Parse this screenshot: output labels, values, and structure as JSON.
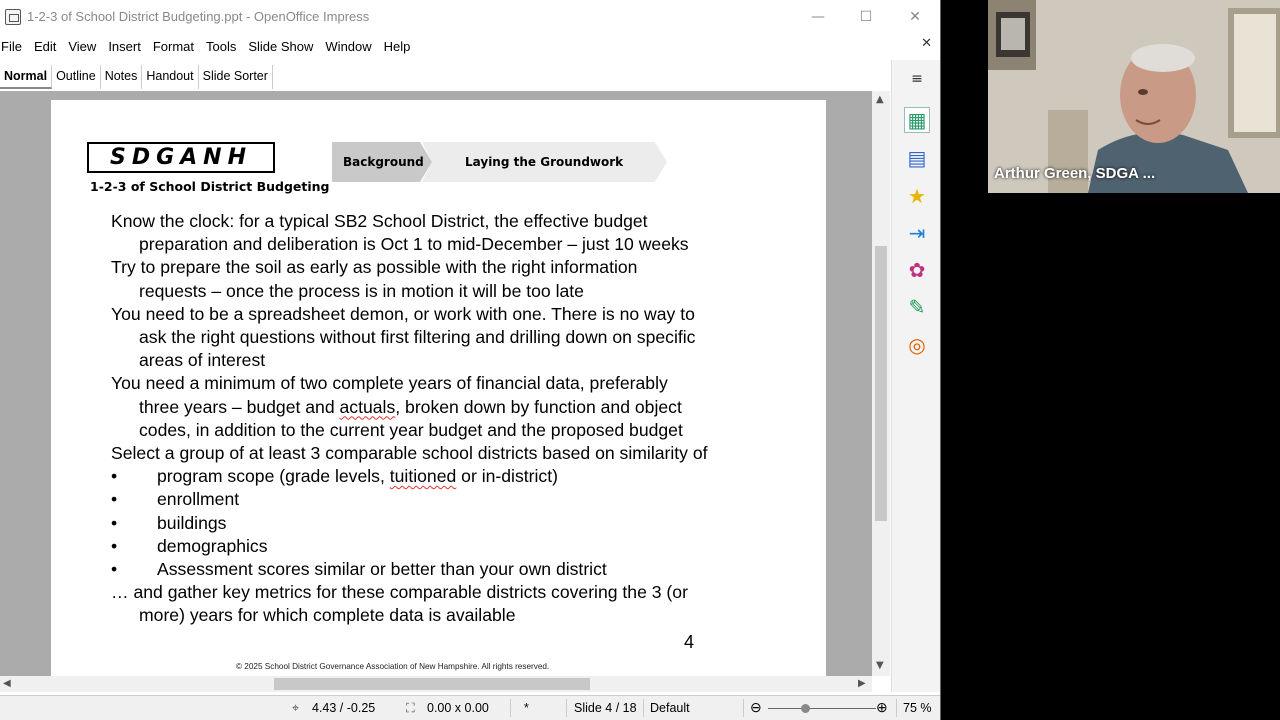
{
  "window": {
    "title": "1-2-3 of School District Budgeting.ppt - OpenOffice Impress",
    "minimize": "—",
    "maximize": "☐",
    "close": "✕",
    "doc_close": "✕"
  },
  "menu": [
    "File",
    "Edit",
    "View",
    "Insert",
    "Format",
    "Tools",
    "Slide Show",
    "Window",
    "Help"
  ],
  "view_tabs": [
    "Normal",
    "Outline",
    "Notes",
    "Handout",
    "Slide Sorter"
  ],
  "active_tab": "Normal",
  "slide": {
    "logo": "SDGANH",
    "logo_subtitle": "1-2-3 of School District Budgeting",
    "breadcrumb": [
      "Background",
      "Laying the Groundwork"
    ],
    "paragraphs": [
      {
        "first": "Know the clock: for a typical SB2 School District, the effective budget",
        "cont": [
          "preparation and deliberation is Oct 1 to mid-December – just 10 weeks"
        ]
      },
      {
        "first": "Try to prepare the soil as early as possible with the right information",
        "cont": [
          "requests – once the process is in motion it will be too late"
        ]
      },
      {
        "first": "You need to be a spreadsheet demon, or work with one.  There is no way to",
        "cont": [
          "ask the right questions without first filtering and drilling down on specific",
          "areas of interest"
        ]
      },
      {
        "first": "You need a minimum of two complete years of financial data, preferably",
        "cont_a": "three years – budget and ",
        "cont_b": "actuals",
        "cont_c": ", broken down by function and object",
        "cont": [
          "codes, in addition to the current year budget and the proposed budget"
        ]
      },
      {
        "first": "Select a group of at least 3 comparable school districts based on similarity of"
      }
    ],
    "bullet_char": "•",
    "bullets": [
      {
        "a": "program scope (grade levels, ",
        "b": "tuitioned",
        "c": " or in-district)"
      },
      {
        "a": "enrollment"
      },
      {
        "a": "buildings"
      },
      {
        "a": "demographics"
      },
      {
        "a": "Assessment scores similar or better than your own district"
      }
    ],
    "closing": {
      "first": "… and gather key metrics for these comparable districts covering the 3 (or",
      "cont": "more) years for which complete data is available"
    },
    "page_number": "4",
    "copyright": "© 2025 School District Governance Association of New Hampshire.    All rights reserved."
  },
  "sidebar_icons": [
    "menu-icon",
    "properties-icon",
    "master-pages-icon",
    "custom-animation-icon",
    "slide-transition-icon",
    "gallery-icon",
    "styles-icon",
    "navigator-icon"
  ],
  "status": {
    "position": "4.43 / -0.25",
    "size": "0.00 x 0.00",
    "modified": "*",
    "slide": "Slide 4 / 18",
    "layout": "Default",
    "zoom": "75 %"
  },
  "video": {
    "participant": "Arthur Green, SDGA ..."
  }
}
